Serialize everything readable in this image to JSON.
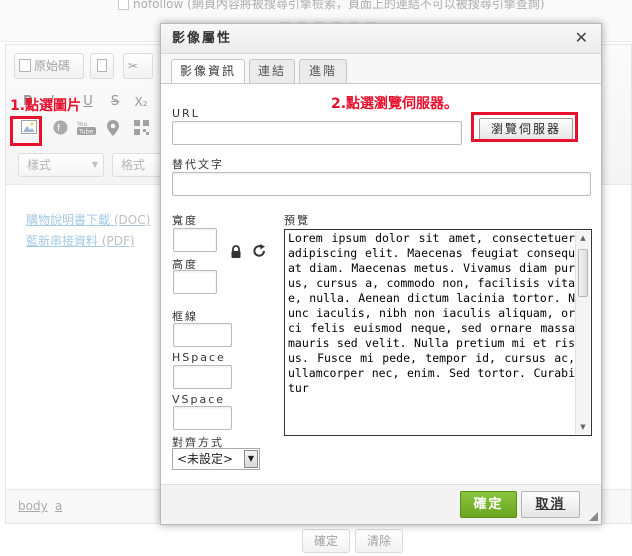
{
  "background": {
    "top_text": "nofollow (網頁內容將被搜尋引擎檢索，頁面上的連結不可以被搜尋引擎查詢)",
    "top_text2": "— — — — — —",
    "toolbar": {
      "source_button": "原始碼",
      "styles_combo": "樣式",
      "format_combo": "格式"
    },
    "links": [
      {
        "text": "購物說明書下載",
        "type": "(DOC)"
      },
      {
        "text": "藍新串接資料",
        "type": "(PDF)"
      }
    ],
    "path": [
      "body",
      "a"
    ],
    "buttons": {
      "confirm": "確定",
      "clear": "清除"
    }
  },
  "annotations": {
    "step1": "1.點選圖片",
    "step2": "2.點選瀏覽伺服器。"
  },
  "dialog": {
    "title": "影像屬性",
    "close": "✕",
    "tabs": [
      "影像資訊",
      "連結",
      "進階"
    ],
    "url_label": "URL",
    "url_value": "",
    "browse_button": "瀏覽伺服器",
    "alt_label": "替代文字",
    "alt_value": "",
    "width_label": "寬度",
    "height_label": "高度",
    "border_label": "框線",
    "hspace_label": "HSpace",
    "vspace_label": "VSpace",
    "align_label": "對齊方式",
    "align_value": "<未設定>",
    "preview_label": "預覽",
    "preview_text": "Lorem ipsum dolor sit amet, consectetuer adipiscing elit. Maecenas feugiat consequat diam. Maecenas metus. Vivamus diam purus, cursus a, commodo non, facilisis vitae, nulla. Aenean dictum lacinia tortor. Nunc iaculis, nibh non iaculis aliquam, orci felis euismod neque, sed ornare massa mauris sed velit. Nulla pretium mi et risus. Fusce mi pede, tempor id, cursus ac, ullamcorper nec, enim. Sed tortor. Curabitur",
    "ok_button": "確定",
    "cancel_button": "取消"
  },
  "colors": {
    "annotation_red": "#e8112d",
    "ok_green": "#7ab733",
    "link_blue": "#5a9fcf"
  }
}
